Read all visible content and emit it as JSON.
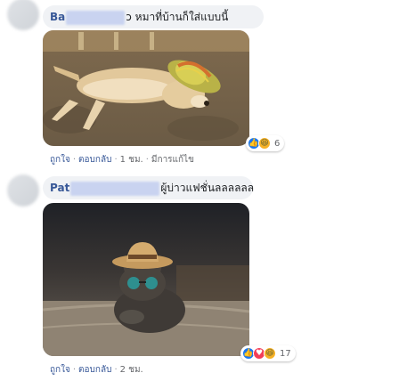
{
  "comments": [
    {
      "name_visible": "Ba",
      "text_visible": "ɔ หมาที่บ้านก็ใส่แบบนี้",
      "image_desc": "dog wearing a straw hat lying on the ground",
      "actions": {
        "like": "ถูกใจ",
        "reply": "ตอบกลับ",
        "time": "1 ชม.",
        "edited": "มีการแก้ไข"
      },
      "reactions": {
        "icons": [
          "like-icon",
          "haha-icon"
        ],
        "count": "6"
      }
    },
    {
      "name_visible": "Pat",
      "text_visible": "ผู้บ่าวแฟชั่นลลลลลล",
      "image_desc": "cat wearing a straw hat and sunglasses",
      "actions": {
        "like": "ถูกใจ",
        "reply": "ตอบกลับ",
        "time": "2 ชม."
      },
      "reactions": {
        "icons": [
          "like-icon",
          "love-icon",
          "haha-icon"
        ],
        "count": "17"
      }
    }
  ],
  "colors": {
    "name": "#385898",
    "bubble": "#f0f2f5",
    "redaction": "#c9d3f0",
    "meta": "#65676b"
  }
}
